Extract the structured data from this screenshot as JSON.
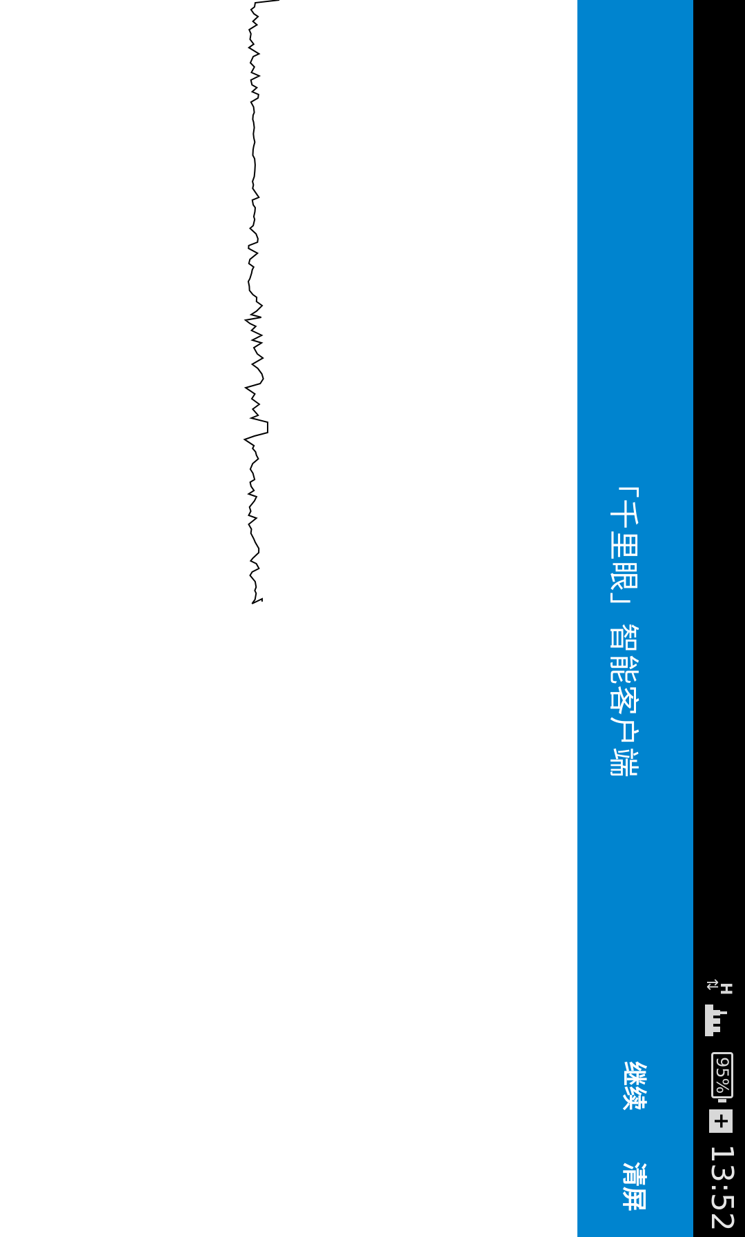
{
  "status_bar": {
    "time": "13:52",
    "battery_percent": "95%",
    "network_type": "H",
    "data_arrows": "⇅",
    "charge_symbol": "+"
  },
  "app_bar": {
    "title": "「千里眼」智能客户端",
    "actions": {
      "continue_label": "继续",
      "clear_label": "清屏"
    },
    "background_color": "#0084cf"
  },
  "waveform": {
    "stroke_color": "#000000"
  }
}
